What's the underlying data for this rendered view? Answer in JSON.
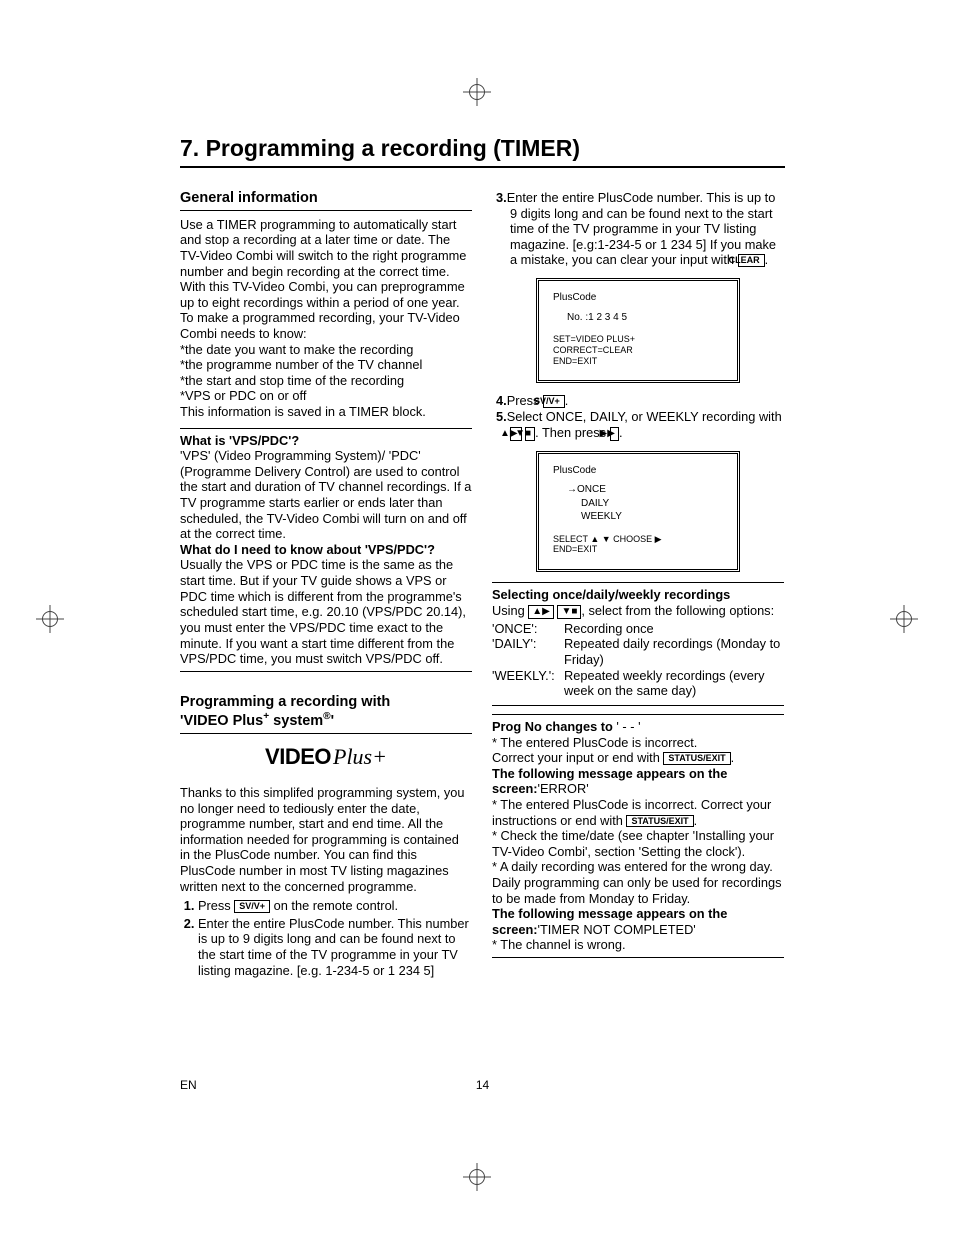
{
  "page": {
    "title": "7. Programming a recording (TIMER)",
    "lang_label": "EN",
    "page_number": "14"
  },
  "general": {
    "heading": "General information",
    "body": "Use a TIMER programming to automatically start and stop a recording at a later time or date. The TV-Video Combi will switch to the right programme number and begin recording at the correct time. With this TV-Video Combi, you can preprogramme up to eight recordings within a period of one year. To make a programmed recording, your TV-Video Combi needs to know:",
    "bullets": [
      "*the date you want to make the recording",
      "*the programme number of the TV channel",
      "*the start and stop time of the recording",
      "*VPS or PDC on or off"
    ],
    "tail": "This information is saved in a TIMER block."
  },
  "vps_box": {
    "h1": "What is 'VPS/PDC'?",
    "p1": "'VPS' (Video Programming System)/ 'PDC' (Programme Delivery Control) are used to control the start and duration of TV channel recordings. If a TV programme starts earlier or ends later than scheduled, the TV-Video Combi will turn on and off at the correct time.",
    "h2": "What do I need to know about 'VPS/PDC'?",
    "p2": "Usually the VPS or PDC time is the same as the start time. But if your TV guide shows a VPS or PDC time which is different from the programme's scheduled start time, e.g. 20.10 (VPS/PDC 20.14), you must enter the VPS/PDC time exact to the minute. If you want a start time different from the VPS/PDC time, you must switch VPS/PDC off."
  },
  "videoplus": {
    "heading_l1": "Programming a recording with",
    "heading_l2_pre": "'VIDEO Plus",
    "heading_l2_post": " system",
    "heading_l2_end": "'",
    "logo_word": "VIDEO",
    "logo_script": "Plus+",
    "intro": "Thanks to this simplifed programming system, you no longer need to tediously enter the date, programme number, start and end time. All the information needed for programming is contained in the PlusCode number. You can find this PlusCode number in most TV listing magazines written next to the concerned programme.",
    "step1_pre": "Press ",
    "step1_post": " on the remote control.",
    "step2": "Enter the entire PlusCode number. This number is up to 9 digits long and can be found next to the start time of the TV programme in your TV listing magazine. [e.g. 1-234-5 or 1 234 5]"
  },
  "right": {
    "step3": "Enter the entire PlusCode number. This is up to 9 digits long and can be found next to the start time of the TV programme in your TV listing magazine. [e.g:1-234-5 or 1 234 5] If you make a mistake, you can clear your input with ",
    "step3_end": ".",
    "step4_pre": "Press ",
    "step4_post": ".",
    "step5_pre": "Select ONCE, DAILY, or WEEKLY recording with ",
    "step5_mid": ". Then press ",
    "step5_post": "."
  },
  "buttons": {
    "svv": "SV/V+",
    "clear": "CLEAR",
    "status": "STATUS/EXIT",
    "up": "▲▶",
    "down": "▼■",
    "fwd": "▶▶"
  },
  "osd1": {
    "title": "PlusCode",
    "line": "No. :1 2 3 4 5",
    "f1": "SET=VIDEO PLUS+",
    "f2": "CORRECT=CLEAR",
    "f3": "END=EXIT"
  },
  "osd2": {
    "title": "PlusCode",
    "opt1": "→ONCE",
    "opt2": "DAILY",
    "opt3": "WEEKLY",
    "f1": "SELECT ▲ ▼  CHOOSE ▶",
    "f2": "END=EXIT"
  },
  "select_box": {
    "h": "Selecting once/daily/weekly recordings",
    "lead_pre": "Using ",
    "lead_post": ", select from the following options:",
    "once_k": "'ONCE':",
    "once_v": "Recording once",
    "daily_k": "'DAILY':",
    "daily_v": "Repeated daily recordings (Monday to Friday)",
    "weekly_k": "'WEEKLY.':",
    "weekly_v": "Repeated weekly recordings (every week on the same day)"
  },
  "prog_box": {
    "h_pre": "Prog No changes to",
    "h_post": " ' - - '",
    "l1": "* The entered PlusCode is incorrect.",
    "l2_pre": "Correct your input or end with ",
    "l2_post": ".",
    "h2_a": "The following message appears on the screen:",
    "h2_b": "'ERROR'",
    "l3_pre": "* The entered PlusCode is incorrect. Correct your instructions or end with ",
    "l3_post": ".",
    "l4": "* Check the time/date (see chapter 'Installing your TV-Video Combi', section 'Setting the clock').",
    "l5": "* A daily recording was entered for the wrong day. Daily programming can only be used for recordings to be made from Monday to Friday.",
    "h3_a": "The following message appears on the screen:",
    "h3_b": "'TIMER NOT COMPLETED'",
    "l6": "* The channel is wrong."
  }
}
